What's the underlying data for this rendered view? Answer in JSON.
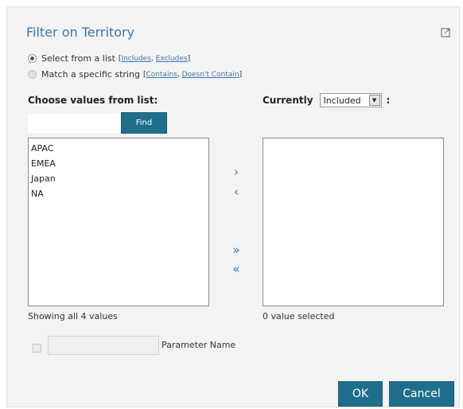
{
  "dialog": {
    "title": "Filter on Territory"
  },
  "radios": {
    "select_from_list": {
      "label": "Select from a list",
      "links_open": "[",
      "includes": "Includes",
      "sep": ", ",
      "excludes": "Excludes",
      "links_close": "]",
      "checked": true
    },
    "match_string": {
      "label": "Match a specific string",
      "links_open": "[",
      "contains": "Contains",
      "sep": ", ",
      "doesnt_contain": "Doesn't Contain",
      "links_close": "]",
      "checked": false
    }
  },
  "left": {
    "heading": "Choose values from list:",
    "search_value": "",
    "find_label": "Find",
    "items": [
      "APAC",
      "EMEA",
      "Japan",
      "NA"
    ],
    "status": "Showing all 4 values"
  },
  "transfer": {
    "add": "›",
    "remove": "‹",
    "add_all": "»",
    "remove_all": "«"
  },
  "right": {
    "heading": "Currently",
    "mode_value": "Included",
    "colon": ":",
    "items": [],
    "status": "0 value selected"
  },
  "parameter": {
    "checked": false,
    "value": "",
    "label": "Parameter Name"
  },
  "footer": {
    "ok_label": "OK",
    "cancel_label": "Cancel"
  },
  "colors": {
    "accent": "#3a76b3",
    "button": "#1f6f8b",
    "panel": "#f3f3f3"
  }
}
